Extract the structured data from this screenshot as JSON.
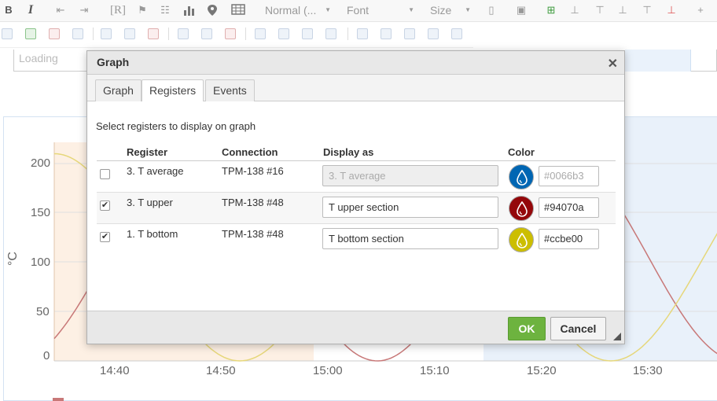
{
  "toolbar": {
    "bold": "B",
    "italic": "I",
    "ref": "[R]",
    "format_select": "Normal (...",
    "font_select": "Font",
    "size_select": "Size"
  },
  "loading_text": "Loading",
  "chart": {
    "ylabel": "°C",
    "y_ticks": [
      "200",
      "150",
      "100",
      "50",
      "0"
    ],
    "x_ticks": [
      "14:40",
      "14:50",
      "15:00",
      "15:10",
      "15:20",
      "15:30"
    ]
  },
  "chart_data": {
    "type": "line",
    "ylabel": "°C",
    "ylim": [
      0,
      220
    ],
    "y_ticks": [
      0,
      50,
      100,
      150,
      200
    ],
    "x_ticks": [
      "14:40",
      "14:50",
      "15:00",
      "15:10",
      "15:20",
      "15:30"
    ],
    "series": [
      {
        "color": "#94070a",
        "description_values": "sinusoid"
      },
      {
        "color": "#ccbe00",
        "description_values": "sinusoid"
      }
    ]
  },
  "dialog": {
    "title": "Graph",
    "tabs": [
      "Graph",
      "Registers",
      "Events"
    ],
    "active_tab": "Registers",
    "subtitle": "Select registers to display on graph",
    "columns": [
      "Register",
      "Connection",
      "Display as",
      "Color"
    ],
    "rows": [
      {
        "checked": false,
        "register": "3. T average",
        "connection": "TPM-138 #16",
        "display_as": "3. T average",
        "color": "#0066b3",
        "disabled": true
      },
      {
        "checked": true,
        "register": "3. T upper",
        "connection": "TPM-138 #48",
        "display_as": "T upper section",
        "color": "#94070a",
        "disabled": false
      },
      {
        "checked": true,
        "register": "1. T bottom",
        "connection": "TPM-138 #48",
        "display_as": "T bottom section",
        "color": "#ccbe00",
        "disabled": false
      }
    ],
    "ok_label": "OK",
    "cancel_label": "Cancel"
  }
}
